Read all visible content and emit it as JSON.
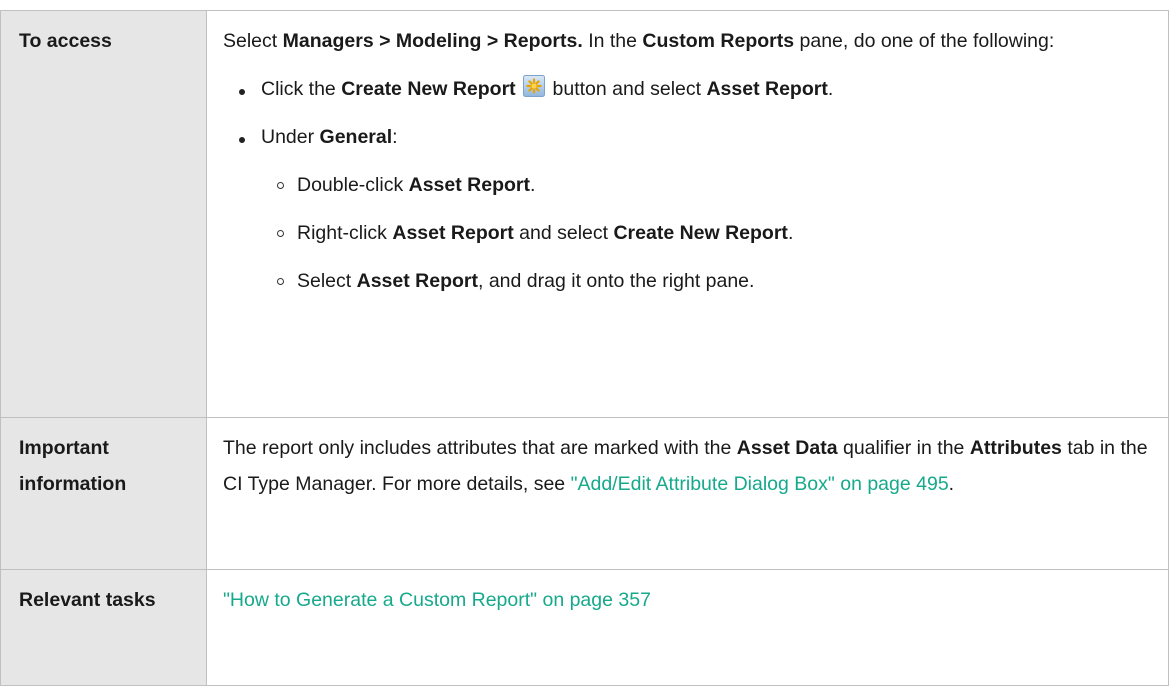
{
  "rows": [
    {
      "label": "To access",
      "intro": {
        "t1": "Select ",
        "b1": "Managers > Modeling > Reports.",
        "t2": " In the ",
        "b2": "Custom Reports",
        "t3": " pane, do one of the following:"
      },
      "bullet1": {
        "t1": "Click the ",
        "b1": "Create New Report",
        "t2": " button and select ",
        "b2": "Asset Report",
        "t3": "."
      },
      "bullet2": {
        "t1": "Under ",
        "b1": "General",
        "t2": ":"
      },
      "sub1": {
        "t1": "Double-click ",
        "b1": "Asset Report",
        "t2": "."
      },
      "sub2": {
        "t1": "Right-click ",
        "b1": "Asset Report",
        "t2": " and select ",
        "b2": "Create New Report",
        "t3": "."
      },
      "sub3": {
        "t1": "Select ",
        "b1": "Asset Report",
        "t2": ", and drag it onto the right pane."
      }
    },
    {
      "label": "Important information",
      "t1": "The report only includes attributes that are marked with the ",
      "b1": "Asset Data",
      "t2": " qualifier in the ",
      "b2": "Attributes",
      "t3": " tab in the CI Type Manager. For more details, see ",
      "link": "\"Add/Edit Attribute Dialog Box\" on page 495",
      "t4": "."
    },
    {
      "label": "Relevant tasks",
      "link": "\"How to Generate a Custom Report\" on page 357"
    }
  ],
  "icons": {
    "create_new_report": "create-new-report-icon",
    "accent": "#17a98b"
  }
}
